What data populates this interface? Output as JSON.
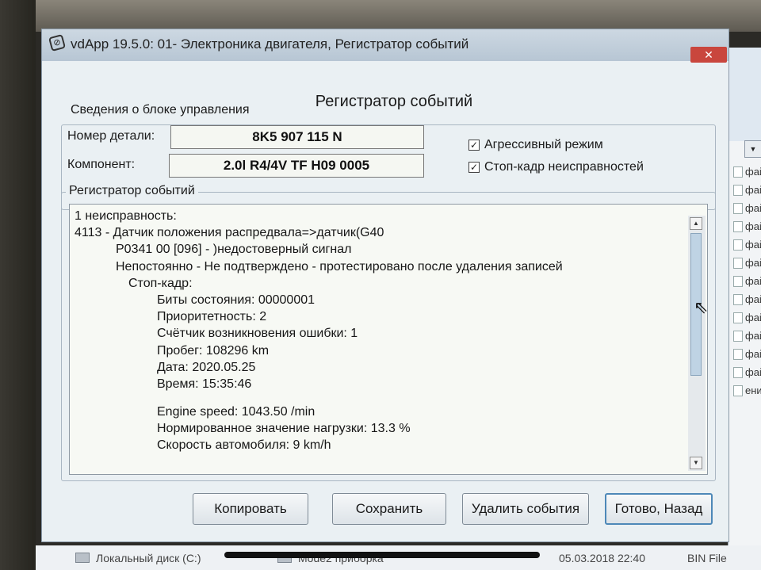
{
  "window": {
    "title": "vdApp 19.5.0: 01- Электроника двигателя, Регистратор событий",
    "close_label": "✕"
  },
  "dialog": {
    "title": "Регистратор событий"
  },
  "control_unit_info": {
    "legend": "Сведения о блоке управления",
    "part_number_label": "Номер детали:",
    "part_number_value": "8K5 907 115 N",
    "component_label": "Компонент:",
    "component_value": "2.0l R4/4V TF H09 0005",
    "aggressive_mode": {
      "label": "Агрессивный режим",
      "checked": true
    },
    "freeze_frame": {
      "label": "Стоп-кадр неисправностей",
      "checked": true
    }
  },
  "event_log": {
    "legend": "Регистратор событий",
    "lines": [
      {
        "indent": 0,
        "text": "1 неисправность:"
      },
      {
        "indent": 0,
        "text": "4113 - Датчик положения распредвала=>датчик(G40"
      },
      {
        "indent": 1,
        "text": "P0341 00 [096] - )недостоверный сигнал"
      },
      {
        "indent": 1,
        "text": "Непостоянно - Не подтверждено - протестировано после удаления записей"
      },
      {
        "indent": 2,
        "text": "Стоп-кадр:"
      },
      {
        "indent": 3,
        "text": "Биты состояния: 00000001"
      },
      {
        "indent": 3,
        "text": "Приоритетность: 2"
      },
      {
        "indent": 3,
        "text": "Счётчик возникновения ошибки: 1"
      },
      {
        "indent": 3,
        "text": "Пробег: 108296 km"
      },
      {
        "indent": 3,
        "text": "Дата: 2020.05.25"
      },
      {
        "indent": 3,
        "text": "Время: 15:35:46"
      },
      {
        "indent": 3,
        "text": ""
      },
      {
        "indent": 3,
        "text": "Engine speed: 1043.50 /min"
      },
      {
        "indent": 3,
        "text": "Нормированное значение нагрузки: 13.3 %"
      },
      {
        "indent": 3,
        "text": "Скорость автомобиля: 9 km/h"
      }
    ],
    "scroll_up": "▲",
    "scroll_down": "▼"
  },
  "buttons": {
    "copy": "Копировать",
    "save": "Сохранить",
    "delete_events": "Удалить события",
    "done_back": "Готово, Назад"
  },
  "background": {
    "list_items": [
      "файл",
      "файл",
      "файл",
      "файл",
      "файл",
      "файл",
      "файл",
      "файл",
      "файл",
      "файл",
      "файл",
      "файл",
      "ение"
    ],
    "combo_arrow": "▼",
    "bottom_items": {
      "disk": "Локальный диск (C:)",
      "folder": "Mode2 приборка",
      "date": "05.03.2018 22:40",
      "type": "BIN File"
    }
  }
}
